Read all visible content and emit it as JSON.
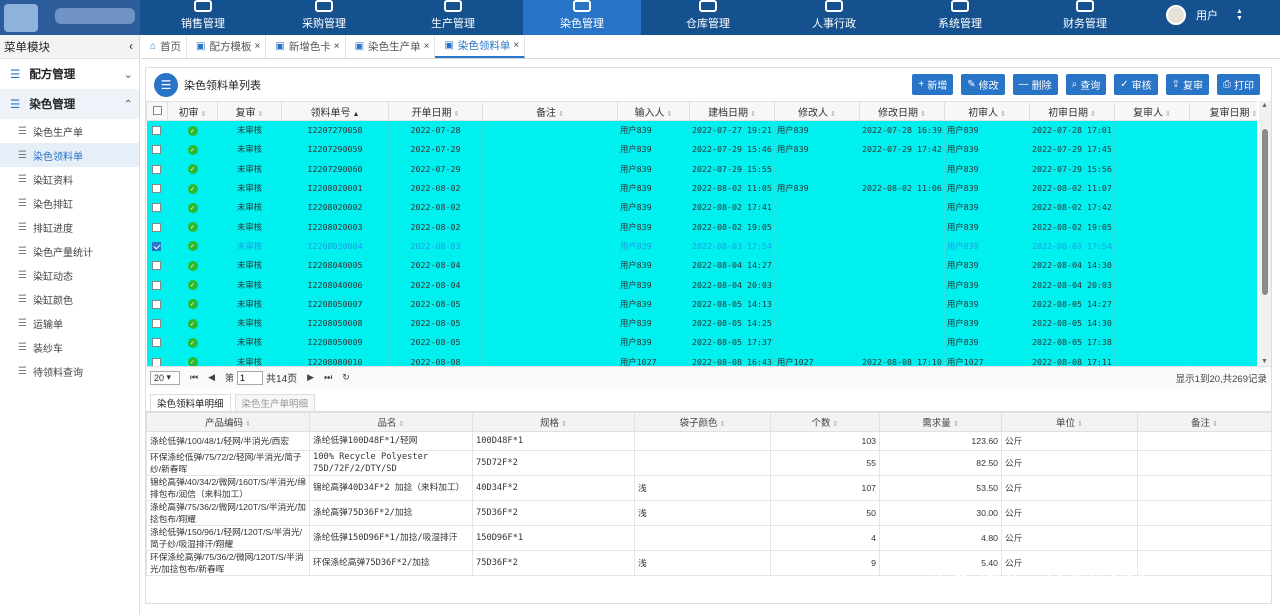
{
  "nav": [
    {
      "label": "销售管理",
      "icon": "sales-icon"
    },
    {
      "label": "采购管理",
      "icon": "purchase-icon"
    },
    {
      "label": "生产管理",
      "icon": "production-icon"
    },
    {
      "label": "染色管理",
      "icon": "dyeing-icon",
      "active": true
    },
    {
      "label": "仓库管理",
      "icon": "warehouse-icon"
    },
    {
      "label": "人事行政",
      "icon": "hr-icon"
    },
    {
      "label": "系统管理",
      "icon": "system-icon"
    },
    {
      "label": "财务管理",
      "icon": "finance-icon"
    }
  ],
  "user": {
    "name": "用户"
  },
  "sidebar": {
    "title": "菜单模块",
    "groups": [
      {
        "label": "配方管理"
      },
      {
        "label": "染色管理"
      }
    ],
    "items": [
      "染色生产单",
      "染色领料单",
      "染缸资料",
      "染色排缸",
      "排缸进度",
      "染色产量统计",
      "染缸动态",
      "染缸颜色",
      "运输单",
      "装纱车",
      "待领料查询"
    ],
    "active_item": "染色领料单"
  },
  "tabs": [
    {
      "label": "首页",
      "closable": false
    },
    {
      "label": "配方模板",
      "closable": true
    },
    {
      "label": "新增色卡",
      "closable": true
    },
    {
      "label": "染色生产单",
      "closable": true
    },
    {
      "label": "染色领料单",
      "closable": true,
      "active": true
    }
  ],
  "panel": {
    "title": "染色领料单列表"
  },
  "toolbar": [
    {
      "label": "新增",
      "icon": "plus-icon"
    },
    {
      "label": "修改",
      "icon": "edit-icon"
    },
    {
      "label": "删除",
      "icon": "minus-icon"
    },
    {
      "label": "查询",
      "icon": "search-icon"
    },
    {
      "label": "审核",
      "icon": "approve-icon"
    },
    {
      "label": "复审",
      "icon": "upload-icon"
    },
    {
      "label": "打印",
      "icon": "print-icon"
    }
  ],
  "grid": {
    "columns": [
      "初审",
      "复审",
      "领料单号",
      "开单日期",
      "备注",
      "输入人",
      "建档日期",
      "修改人",
      "修改日期",
      "初审人",
      "初审日期",
      "复审人",
      "复审日期"
    ],
    "rows": [
      {
        "checked": false,
        "status": "未审核",
        "no": "I2207270058",
        "date": "2022-07-28",
        "remark": "",
        "input": "用户839",
        "created": "2022-07-27 19:21",
        "modifier": "用户839",
        "modified": "2022-07-28 16:39",
        "auditor": "用户839",
        "audit_date": "2022-07-28 17:01",
        "reviewer": "",
        "review_date": ""
      },
      {
        "checked": false,
        "status": "未审核",
        "no": "I2207290059",
        "date": "2022-07-29",
        "remark": "",
        "input": "用户839",
        "created": "2022-07-29 15:46",
        "modifier": "用户839",
        "modified": "2022-07-29 17:42",
        "auditor": "用户839",
        "audit_date": "2022-07-29 17:45",
        "reviewer": "",
        "review_date": ""
      },
      {
        "checked": false,
        "status": "未审核",
        "no": "I2207290060",
        "date": "2022-07-29",
        "remark": "",
        "input": "用户839",
        "created": "2022-07-29 15:55",
        "modifier": "",
        "modified": "",
        "auditor": "用户839",
        "audit_date": "2022-07-29 15:56",
        "reviewer": "",
        "review_date": ""
      },
      {
        "checked": false,
        "status": "未审核",
        "no": "I2208020001",
        "date": "2022-08-02",
        "remark": "",
        "input": "用户839",
        "created": "2022-08-02 11:05",
        "modifier": "用户839",
        "modified": "2022-08-02 11:06",
        "auditor": "用户839",
        "audit_date": "2022-08-02 11:07",
        "reviewer": "",
        "review_date": ""
      },
      {
        "checked": false,
        "status": "未审核",
        "no": "I2208020002",
        "date": "2022-08-02",
        "remark": "",
        "input": "用户839",
        "created": "2022-08-02 17:41",
        "modifier": "",
        "modified": "",
        "auditor": "用户839",
        "audit_date": "2022-08-02 17:42",
        "reviewer": "",
        "review_date": ""
      },
      {
        "checked": false,
        "status": "未审核",
        "no": "I2208020003",
        "date": "2022-08-02",
        "remark": "",
        "input": "用户839",
        "created": "2022-08-02 19:05",
        "modifier": "",
        "modified": "",
        "auditor": "用户839",
        "audit_date": "2022-08-02 19:05",
        "reviewer": "",
        "review_date": ""
      },
      {
        "checked": true,
        "status": "未审核",
        "no": "I2208030004",
        "date": "2022-08-03",
        "remark": "",
        "input": "用户839",
        "created": "2022-08-03 17:54",
        "modifier": "",
        "modified": "",
        "auditor": "用户839",
        "audit_date": "2022-08-03 17:54",
        "reviewer": "",
        "review_date": "",
        "selected": true
      },
      {
        "checked": false,
        "status": "未审核",
        "no": "I2208040005",
        "date": "2022-08-04",
        "remark": "",
        "input": "用户839",
        "created": "2022-08-04 14:27",
        "modifier": "",
        "modified": "",
        "auditor": "用户839",
        "audit_date": "2022-08-04 14:30",
        "reviewer": "",
        "review_date": ""
      },
      {
        "checked": false,
        "status": "未审核",
        "no": "I2208040006",
        "date": "2022-08-04",
        "remark": "",
        "input": "用户839",
        "created": "2022-08-04 20:03",
        "modifier": "",
        "modified": "",
        "auditor": "用户839",
        "audit_date": "2022-08-04 20:03",
        "reviewer": "",
        "review_date": ""
      },
      {
        "checked": false,
        "status": "未审核",
        "no": "I2208050007",
        "date": "2022-08-05",
        "remark": "",
        "input": "用户839",
        "created": "2022-08-05 14:13",
        "modifier": "",
        "modified": "",
        "auditor": "用户839",
        "audit_date": "2022-08-05 14:27",
        "reviewer": "",
        "review_date": ""
      },
      {
        "checked": false,
        "status": "未审核",
        "no": "I2208050008",
        "date": "2022-08-05",
        "remark": "",
        "input": "用户839",
        "created": "2022-08-05 14:25",
        "modifier": "",
        "modified": "",
        "auditor": "用户839",
        "audit_date": "2022-08-05 14:30",
        "reviewer": "",
        "review_date": ""
      },
      {
        "checked": false,
        "status": "未审核",
        "no": "I2208050009",
        "date": "2022-08-05",
        "remark": "",
        "input": "用户839",
        "created": "2022-08-05 17:37",
        "modifier": "",
        "modified": "",
        "auditor": "用户839",
        "audit_date": "2022-08-05 17:38",
        "reviewer": "",
        "review_date": ""
      },
      {
        "checked": false,
        "status": "未审核",
        "no": "I2208080010",
        "date": "2022-08-08",
        "remark": "",
        "input": "用户1027",
        "created": "2022-08-08 16:43",
        "modifier": "用户1027",
        "modified": "2022-08-08 17:10",
        "auditor": "用户1027",
        "audit_date": "2022-08-08 17:11",
        "reviewer": "",
        "review_date": ""
      }
    ]
  },
  "pager": {
    "page_size": "20",
    "page_prefix": "第",
    "page": "1",
    "total_pages": "共14页",
    "info": "显示1到20,共269记录"
  },
  "detail": {
    "tabs": [
      "染色领料单明细",
      "染色生产单明细"
    ],
    "columns": [
      "产品编码",
      "品名",
      "规格",
      "袋子颜色",
      "个数",
      "需求量",
      "单位",
      "备注"
    ],
    "rows": [
      {
        "code": "涤纶低弹/100/48/1/轻网/半消光/西宏",
        "name": "涤纶低弹100D48F*1/轻网",
        "spec": "100D48F*1",
        "color": "",
        "count": "103",
        "qty": "123.60",
        "unit": "公斤",
        "remark": ""
      },
      {
        "code": "环保涤纶低弹/75/72/2/轻网/半消光/简子纱/新春晖",
        "name": "100% Recycle Polyester 75D/72F/2/DTY/SD",
        "spec": "75D72F*2",
        "color": "",
        "count": "55",
        "qty": "82.50",
        "unit": "公斤",
        "remark": ""
      },
      {
        "code": "锦纶高弹/40/34/2/微网/160T/S/半消光/绵排包布/润信（来料加工）",
        "name": "锦纶高弹40D34F*2 加捻（来料加工）",
        "spec": "40D34F*2",
        "color": "浅",
        "count": "107",
        "qty": "53.50",
        "unit": "公斤",
        "remark": ""
      },
      {
        "code": "涤纶高弹/75/36/2/微网/120T/S/半消光/加捻包布/翔耀",
        "name": "涤纶高弹75D36F*2/加捻",
        "spec": "75D36F*2",
        "color": "浅",
        "count": "50",
        "qty": "30.00",
        "unit": "公斤",
        "remark": ""
      },
      {
        "code": "涤纶低弹/150/96/1/轻网/120T/S/半消光/简子纱/吸湿排汗/翔耀",
        "name": "涤纶低弹150D96F*1/加捻/吸湿排汗",
        "spec": "150D96F*1",
        "color": "",
        "count": "4",
        "qty": "4.80",
        "unit": "公斤",
        "remark": ""
      },
      {
        "code": "环保涤纶高弹/75/36/2/微网/120T/S/半消光/加捻包布/新春晖",
        "name": "环保涤纶高弹75D36F*2/加捻",
        "spec": "75D36F*2",
        "color": "浅",
        "count": "9",
        "qty": "5.40",
        "unit": "公斤",
        "remark": ""
      }
    ]
  },
  "watermark": "头条 @我是IT农民李工"
}
